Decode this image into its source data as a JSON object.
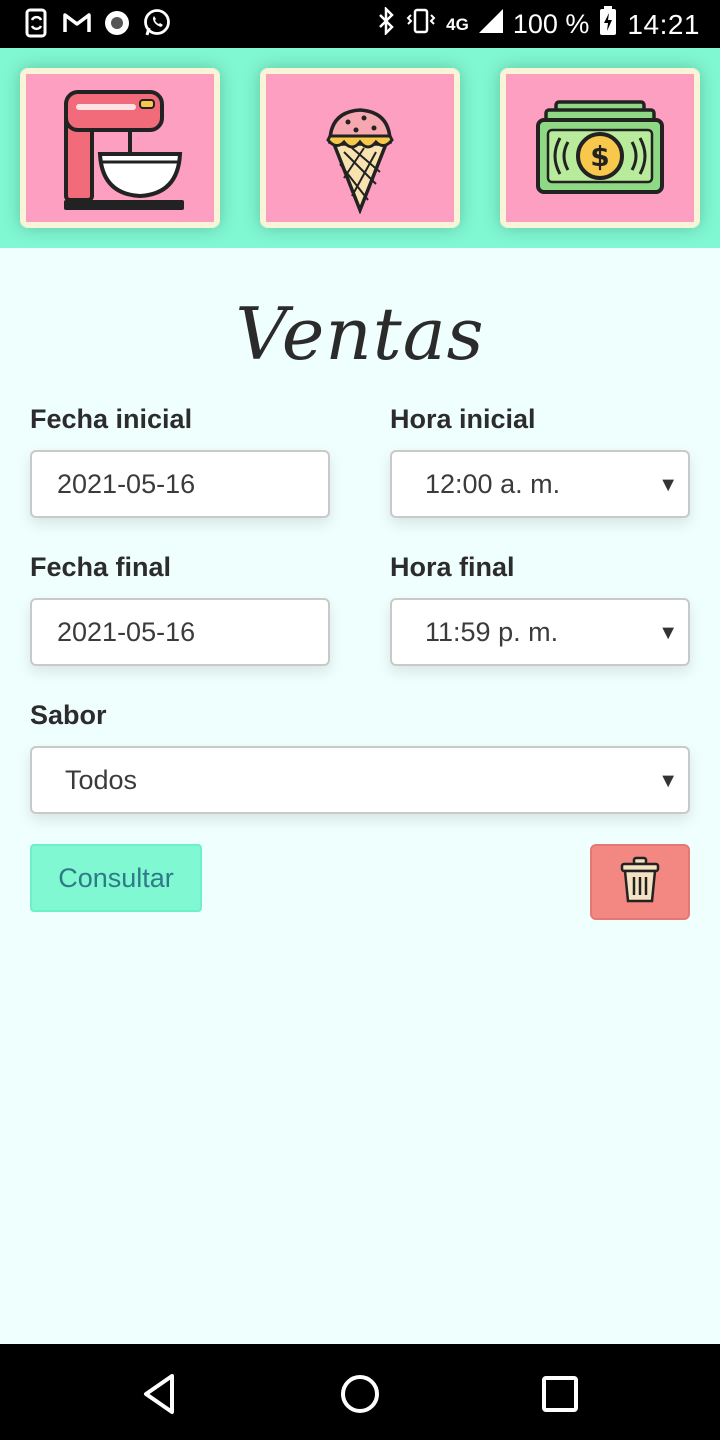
{
  "status_bar": {
    "network": "4G",
    "battery": "100 %",
    "time": "14:21"
  },
  "nav_tiles": [
    {
      "icon": "stand-mixer-icon"
    },
    {
      "icon": "ice-cream-cone-icon"
    },
    {
      "icon": "money-bill-icon"
    }
  ],
  "page": {
    "title": "Ventas"
  },
  "form": {
    "fecha_inicial": {
      "label": "Fecha inicial",
      "value": "2021-05-16"
    },
    "hora_inicial": {
      "label": "Hora inicial",
      "value": "12:00 a. m."
    },
    "fecha_final": {
      "label": "Fecha final",
      "value": "2021-05-16"
    },
    "hora_final": {
      "label": "Hora final",
      "value": "11:59 p. m."
    },
    "sabor": {
      "label": "Sabor",
      "value": "Todos"
    }
  },
  "actions": {
    "consultar_label": "Consultar",
    "delete_icon": "trash-icon"
  },
  "colors": {
    "accent": "#80f8d2",
    "tile_bg": "#fd9fc0",
    "delete_bg": "#f38883",
    "page_bg": "#effffd"
  }
}
